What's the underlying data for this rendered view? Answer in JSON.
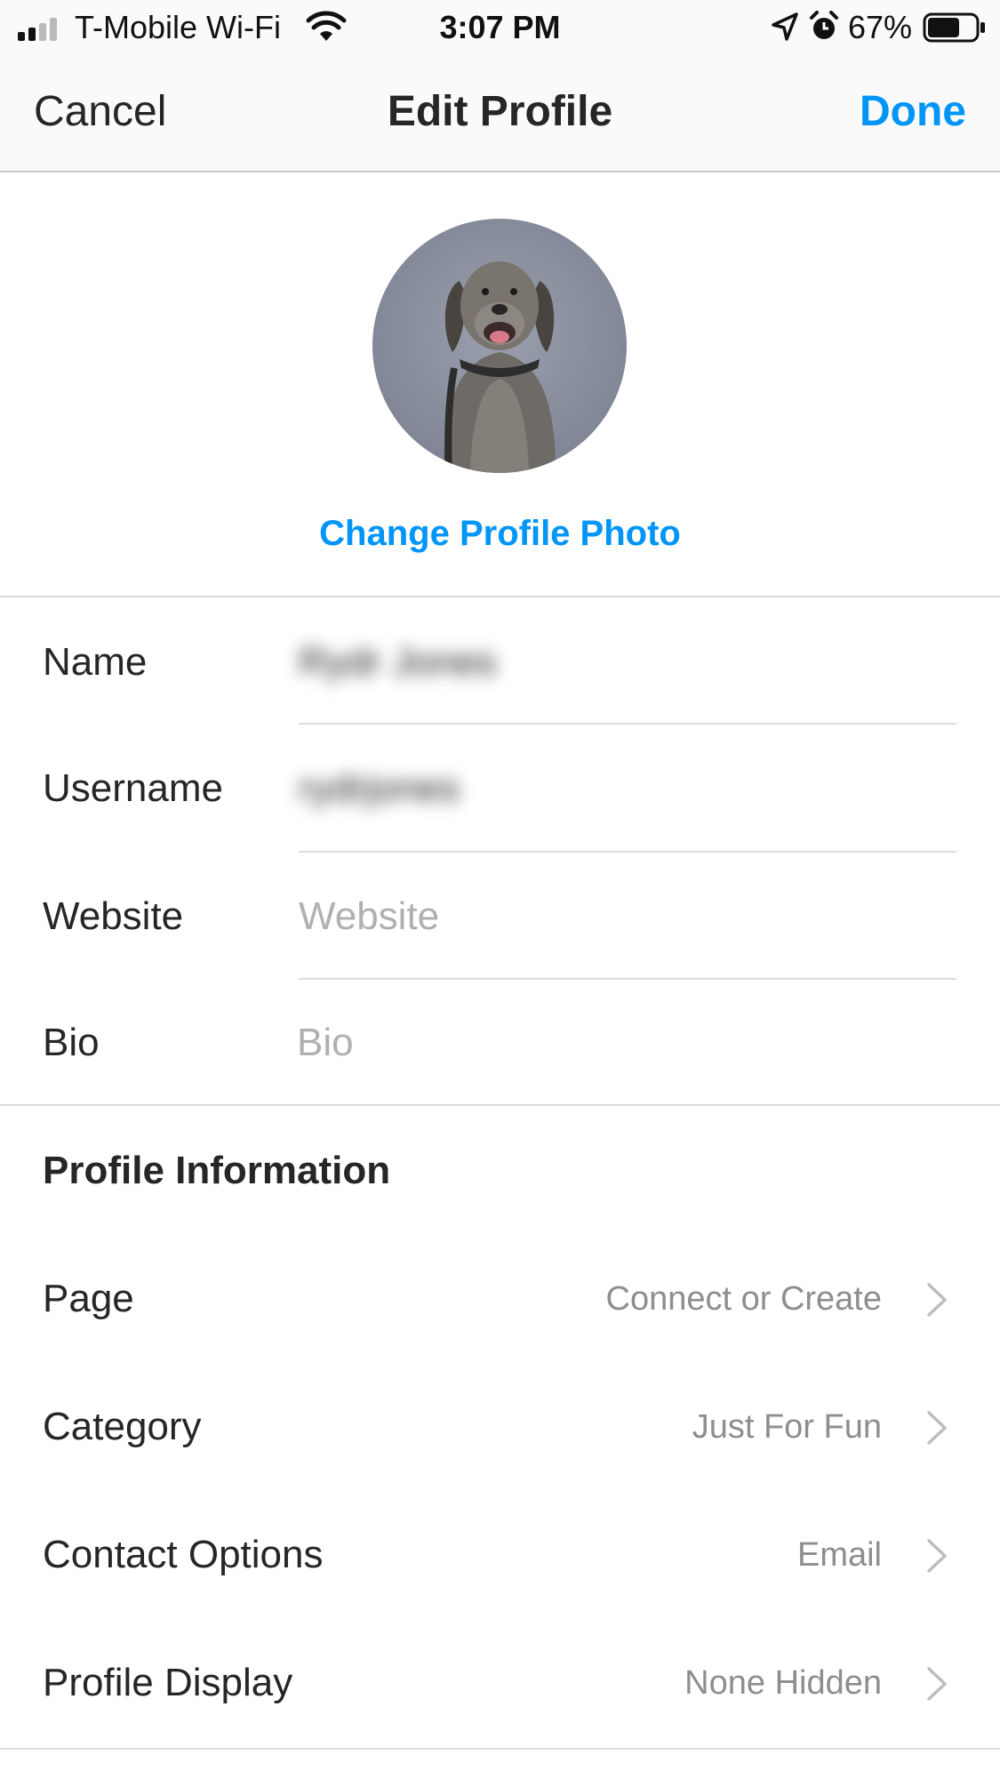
{
  "status_bar": {
    "carrier": "T-Mobile Wi-Fi",
    "time": "3:07 PM",
    "battery": "67%",
    "battery_level": 0.67
  },
  "nav": {
    "cancel": "Cancel",
    "title": "Edit Profile",
    "done": "Done",
    "accent_color": "#0095f6"
  },
  "profile_photo": {
    "change_label": "Change Profile Photo"
  },
  "fields": {
    "name": {
      "label": "Name",
      "value": "Rydr Jones"
    },
    "username": {
      "label": "Username",
      "value": "rydrjones"
    },
    "website": {
      "label": "Website",
      "placeholder": "Website"
    },
    "bio": {
      "label": "Bio",
      "placeholder": "Bio"
    }
  },
  "profile_information": {
    "heading": "Profile Information",
    "rows": [
      {
        "label": "Page",
        "value": "Connect or Create"
      },
      {
        "label": "Category",
        "value": "Just For Fun"
      },
      {
        "label": "Contact Options",
        "value": "Email"
      },
      {
        "label": "Profile Display",
        "value": "None Hidden"
      }
    ]
  },
  "icons": [
    "signal-icon",
    "wifi-icon",
    "location-arrow-icon",
    "alarm-icon",
    "battery-icon",
    "chevron-right-icon",
    "avatar-photo"
  ]
}
